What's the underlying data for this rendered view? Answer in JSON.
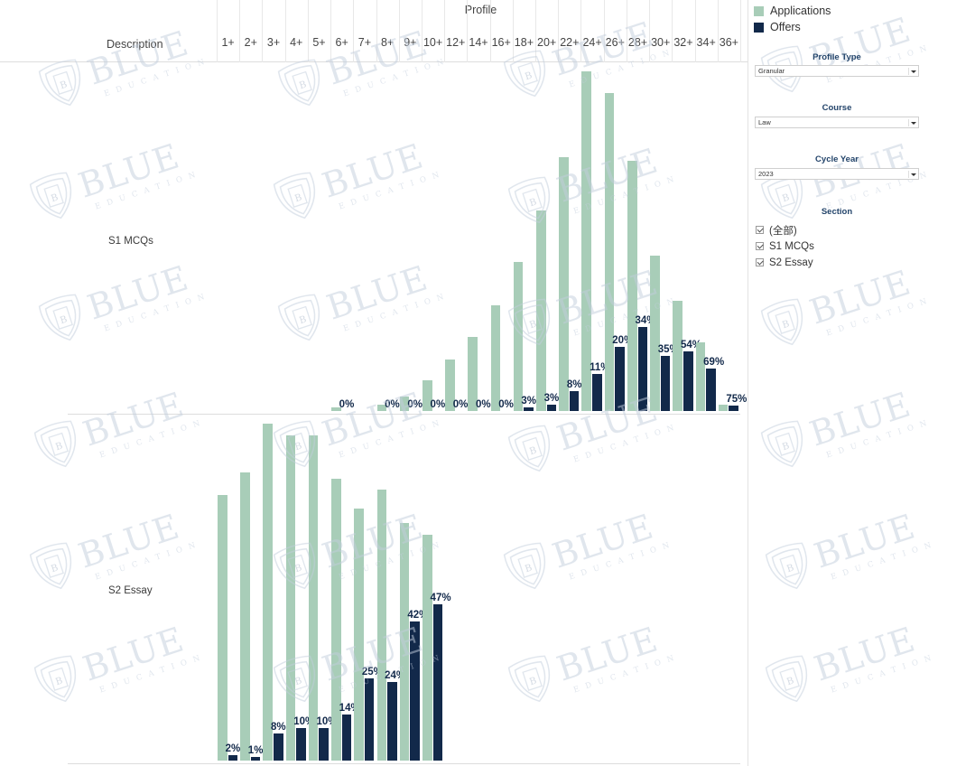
{
  "header": {
    "profile_title": "Profile",
    "description_label": "Description",
    "columns": [
      "1+",
      "2+",
      "3+",
      "4+",
      "5+",
      "6+",
      "7+",
      "8+",
      "9+",
      "10+",
      "12+",
      "14+",
      "16+",
      "18+",
      "20+",
      "22+",
      "24+",
      "26+",
      "28+",
      "30+",
      "32+",
      "34+",
      "36+"
    ]
  },
  "legend": {
    "items": [
      {
        "label": "Applications",
        "color": "#a8cdb8"
      },
      {
        "label": "Offers",
        "color": "#12294a"
      }
    ]
  },
  "controls": {
    "profile_type": {
      "title": "Profile Type",
      "value": "Granular"
    },
    "course": {
      "title": "Course",
      "value": "Law"
    },
    "cycle_year": {
      "title": "Cycle Year",
      "value": "2023"
    },
    "section": {
      "title": "Section",
      "options": [
        {
          "label": "(全部)",
          "checked": true
        },
        {
          "label": "S1 MCQs",
          "checked": true
        },
        {
          "label": "S2 Essay",
          "checked": true
        }
      ]
    }
  },
  "watermark": {
    "word": "BLUE",
    "subword": "E D U C A T I O N",
    "badge_letter": "B"
  },
  "chart_data": [
    {
      "type": "bar",
      "title": "S1 MCQs",
      "row_label": "S1 MCQs",
      "xlabel": "Profile",
      "ylabel": "",
      "grid": true,
      "legend_position": "top-right",
      "categories": [
        "1+",
        "2+",
        "3+",
        "4+",
        "5+",
        "6+",
        "7+",
        "8+",
        "9+",
        "10+",
        "12+",
        "14+",
        "16+",
        "18+",
        "20+",
        "22+",
        "24+",
        "26+",
        "28+",
        "30+",
        "32+",
        "34+",
        "36+"
      ],
      "series": [
        {
          "name": "Applications",
          "values": [
            0,
            0,
            0,
            0,
            0,
            4,
            0,
            6,
            14,
            31,
            51,
            74,
            105,
            148,
            200,
            253,
            338,
            316,
            249,
            155,
            110,
            68,
            6
          ]
        },
        {
          "name": "Offers",
          "values": [
            0,
            0,
            0,
            0,
            0,
            0,
            0,
            0,
            0,
            0,
            0,
            0,
            0,
            4,
            6,
            20,
            37,
            64,
            84,
            55,
            59,
            42,
            5
          ]
        }
      ],
      "offer_rate_labels": [
        null,
        null,
        null,
        null,
        null,
        "0%",
        null,
        "0%",
        "0%",
        "0%",
        "0%",
        "0%",
        "0%",
        "3%",
        "3%",
        "8%",
        "11%",
        "20%",
        "34%",
        "35%",
        "54%",
        "69%",
        "75%"
      ]
    },
    {
      "type": "bar",
      "title": "S2 Essay",
      "row_label": "S2 Essay",
      "xlabel": "Profile",
      "ylabel": "",
      "grid": true,
      "legend_position": "top-right",
      "categories": [
        "1+",
        "2+",
        "3+",
        "4+",
        "5+",
        "6+",
        "7+",
        "8+",
        "9+",
        "10+"
      ],
      "series": [
        {
          "name": "Applications",
          "values": [
            284,
            308,
            360,
            347,
            347,
            301,
            269,
            290,
            254,
            241
          ]
        },
        {
          "name": "Offers",
          "values": [
            6,
            4,
            29,
            35,
            35,
            49,
            88,
            84,
            149,
            167
          ]
        }
      ],
      "offer_rate_labels": [
        "2%",
        "1%",
        "8%",
        "10%",
        "10%",
        "14%",
        "25%",
        "24%",
        "42%",
        "47%"
      ]
    }
  ]
}
